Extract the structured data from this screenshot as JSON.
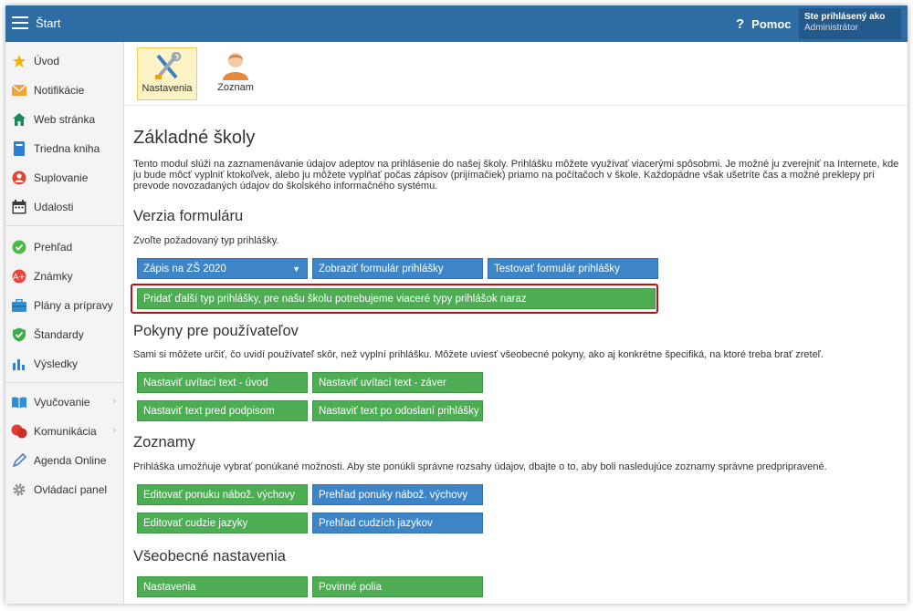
{
  "header": {
    "title": "Štart",
    "help_label": "Pomoc",
    "user_line1": "Ste prihlásený ako",
    "user_line2": "Administrátor"
  },
  "sidebar": {
    "items": [
      {
        "label": "Úvod",
        "icon": "star-icon"
      },
      {
        "label": "Notifikácie",
        "icon": "envelope-icon"
      },
      {
        "label": "Web stránka",
        "icon": "house-icon"
      },
      {
        "label": "Triedna kniha",
        "icon": "book-icon"
      },
      {
        "label": "Suplovanie",
        "icon": "person-swap-icon"
      },
      {
        "label": "Udalosti",
        "icon": "calendar-icon"
      },
      {
        "label": "Prehľad",
        "icon": "check-circle-icon"
      },
      {
        "label": "Známky",
        "icon": "grade-icon"
      },
      {
        "label": "Plány a prípravy",
        "icon": "briefcase-icon"
      },
      {
        "label": "Štandardy",
        "icon": "shield-check-icon"
      },
      {
        "label": "Výsledky",
        "icon": "bar-chart-icon"
      },
      {
        "label": "Vyučovanie",
        "icon": "open-book-icon"
      },
      {
        "label": "Komunikácia",
        "icon": "chat-icon"
      },
      {
        "label": "Agenda Online",
        "icon": "pen-icon"
      },
      {
        "label": "Ovládací panel",
        "icon": "gear-icon"
      }
    ]
  },
  "toolbar": {
    "settings_label": "Nastavenia",
    "list_label": "Zoznam"
  },
  "main": {
    "title": "Základné školy",
    "description": "Tento modul slúži na zaznamenávanie údajov adeptov na prihlásenie do našej školy. Prihlášku môžete využívať viacerými spôsobmi. Je možné ju zverejniť na Internete, kde ju bude môcť vyplniť ktokoľvek, alebo ju môžete vyplňať počas zápisov (prijímačiek) priamo na počítačoch v škole. Každopádne však ušetríte čas a možné preklepy pri prevode novozadaných údajov do školského informačného systému.",
    "version": {
      "heading": "Verzia formuláru",
      "text": "Zvoľte požadovaný typ prihlášky.",
      "select_value": "Zápis na ZŠ 2020",
      "show_button": "Zobraziť formulár prihlášky",
      "test_button": "Testovať formulár prihlášky",
      "add_button": "Pridať ďalší typ prihlášky, pre našu školu potrebujeme viaceré typy prihlášok naraz"
    },
    "instructions": {
      "heading": "Pokyny pre používateľov",
      "text": "Sami si môžete určiť, čo uvidí používateľ skôr, než vyplní prihlášku. Môžete uviesť všeobecné pokyny, ako aj konkrétne špecifiká, na ktoré treba brať zreteľ.",
      "welcome_intro": "Nastaviť uvítací text - úvod",
      "welcome_end": "Nastaviť uvítací text - záver",
      "before_signature": "Nastaviť text pred podpisom",
      "after_submit": "Nastaviť text po odoslaní prihlášky"
    },
    "lists": {
      "heading": "Zoznamy",
      "text": "Prihláška umožňuje vybrať ponúkané možnosti. Aby ste ponúkli správne rozsahy údajov, dbajte o to, aby boli nasledujúce zoznamy správne predpripravené.",
      "edit_religion": "Editovať ponuku nábož. výchovy",
      "view_religion": "Prehľad ponuky nábož. výchovy",
      "edit_languages": "Editovať cudzie jazyky",
      "view_languages": "Prehľad cudzích jazykov"
    },
    "general": {
      "heading": "Všeobecné nastavenia",
      "settings_button": "Nastavenia",
      "required_button": "Povinné polia"
    }
  }
}
